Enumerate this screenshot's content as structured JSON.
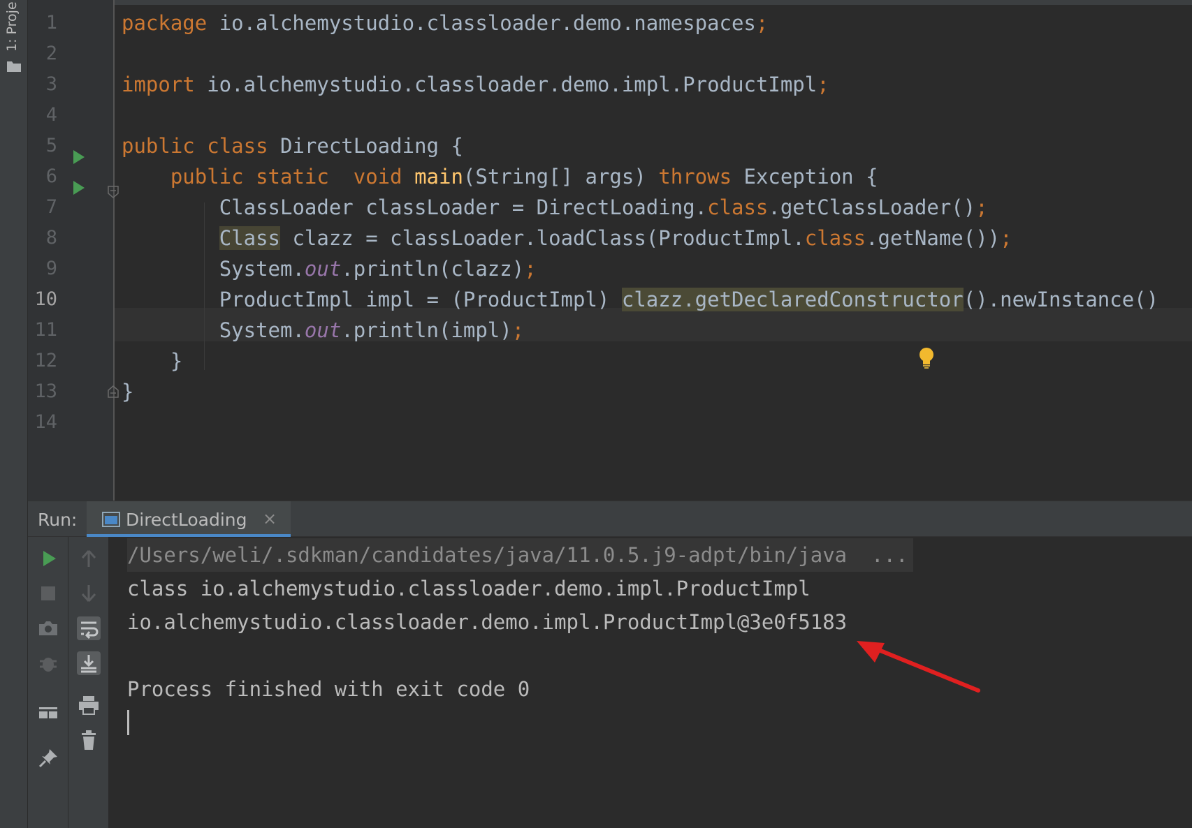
{
  "tool_window": {
    "project_label": "1: Proje"
  },
  "editor": {
    "line_numbers": [
      "1",
      "2",
      "3",
      "4",
      "5",
      "6",
      "7",
      "8",
      "9",
      "10",
      "11",
      "12",
      "13",
      "14"
    ],
    "active_line": "10",
    "lines": {
      "l1": {
        "kw": "package",
        "rest": " io.alchemystudio.classloader.demo.namespaces",
        "semi": ";"
      },
      "l3": {
        "kw": "import",
        "rest": " io.alchemystudio.classloader.demo.impl.ProductImpl",
        "semi": ";"
      },
      "l5": {
        "kw1": "public",
        "kw2": "class",
        "rest": " DirectLoading {"
      },
      "l6": {
        "kw1": "public",
        "kw2": "static",
        "kw3": "void",
        "fn": "main",
        "mid": "(String[] args) ",
        "kw4": "throws",
        "rest": " Exception {"
      },
      "l7": {
        "a": "ClassLoader classLoader = DirectLoading.",
        "kw": "class",
        "b": ".getClassLoader()",
        "semi": ";"
      },
      "l8": {
        "hl": "Class",
        "a": " clazz = classLoader.loadClass(ProductImpl.",
        "kw": "class",
        "b": ".getName())",
        "semi": ";"
      },
      "l9": {
        "a": "System.",
        "fld": "out",
        "b": ".println(clazz)",
        "semi": ";"
      },
      "l10": {
        "a": "ProductImpl impl = (ProductImpl) ",
        "hl": "clazz.getDeclaredConstructor",
        "b": "().newInstance()"
      },
      "l11": {
        "a": "System.",
        "fld": "out",
        "b": ".println(impl)",
        "semi": ";"
      },
      "l12": {
        "a": "}"
      },
      "l13": {
        "a": "}"
      }
    }
  },
  "run_panel": {
    "label": "Run:",
    "tab_label": "DirectLoading",
    "tab_close": "×",
    "output": [
      "/Users/weli/.sdkman/candidates/java/11.0.5.j9-adpt/bin/java  ...",
      "class io.alchemystudio.classloader.demo.impl.ProductImpl",
      "io.alchemystudio.classloader.demo.impl.ProductImpl@3e0f5183",
      "",
      "Process finished with exit code 0"
    ]
  },
  "colors": {
    "editor_bg": "#2b2b2b",
    "keyword": "#cc7832",
    "function": "#ffc66d",
    "field": "#9876aa",
    "plain": "#a9b7c6",
    "run_green": "#499c54",
    "annotation_red": "#e02020",
    "bulb_yellow": "#f2b92e"
  }
}
